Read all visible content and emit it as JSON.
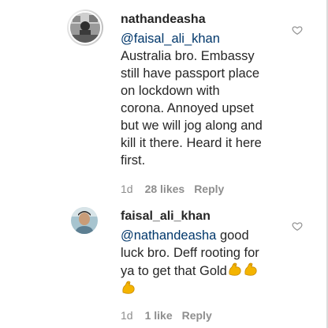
{
  "comments": [
    {
      "username": "nathandeasha",
      "mention": "@faisal_ali_khan",
      "lines": [
        "Australia bro. Embassy",
        "still have passport place",
        "on lockdown with",
        "corona. Annoyed upset",
        "but we will jog along and",
        "kill it there. Heard it here",
        "first."
      ],
      "time": "1d",
      "likes": "28 likes",
      "reply": "Reply"
    },
    {
      "username": "faisal_ali_khan",
      "mention": "@nathandeasha",
      "text_line1_rest": " good",
      "text_line2": "luck bro. Deff rooting for",
      "text_line3": "ya to get that Gold",
      "emoji": "flexed-biceps",
      "time": "1d",
      "likes": "1 like",
      "reply": "Reply"
    }
  ],
  "colors": {
    "text": "#262626",
    "mention": "#00376b",
    "meta": "#8e8e8e",
    "emoji": "#f4b400"
  }
}
